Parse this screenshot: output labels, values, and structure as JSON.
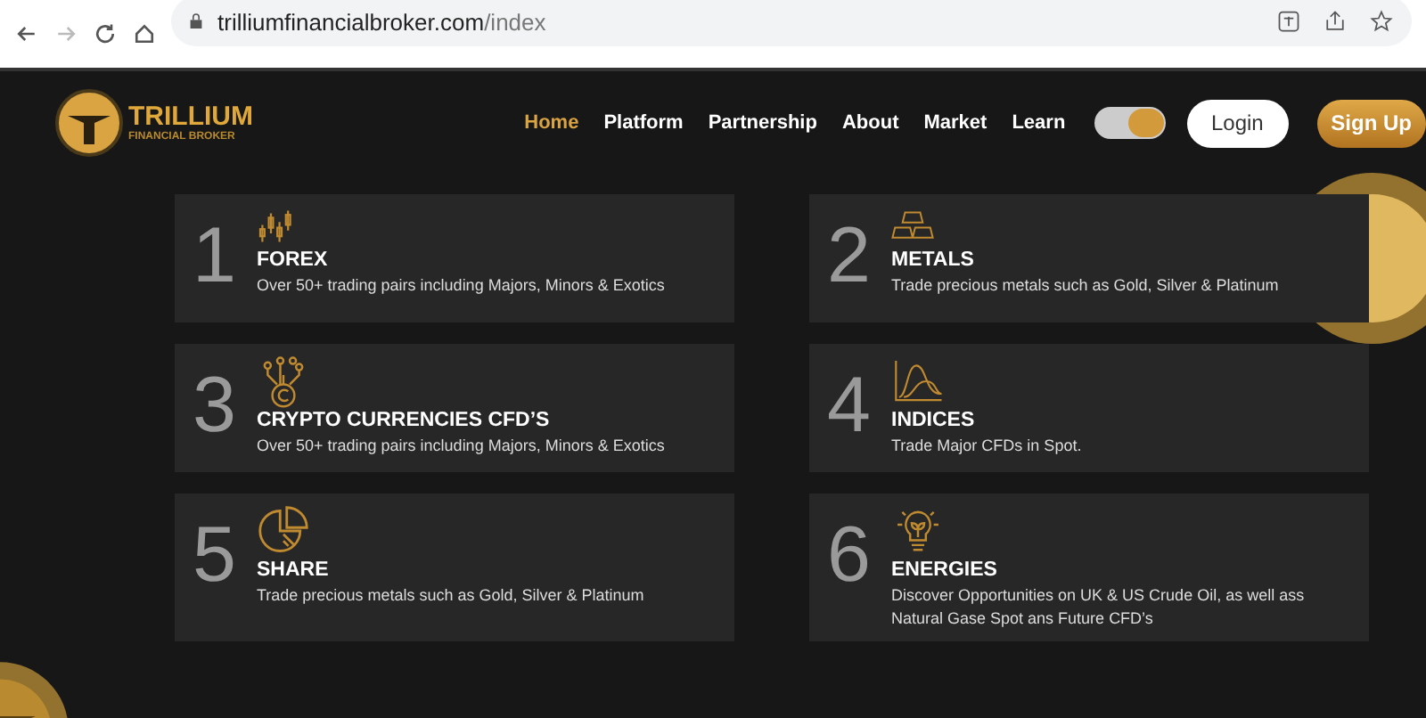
{
  "browser": {
    "url_host": "trilliumfinancialbroker.com",
    "url_path": "/index"
  },
  "logo": {
    "name": "TRILLIUM",
    "tagline": "FINANCIAL BROKER"
  },
  "nav": [
    {
      "label": "Home",
      "selected": true
    },
    {
      "label": "Platform",
      "selected": false
    },
    {
      "label": "Partnership",
      "selected": false
    },
    {
      "label": "About",
      "selected": false
    },
    {
      "label": "Market",
      "selected": false
    },
    {
      "label": "Learn",
      "selected": false
    }
  ],
  "theme_toggle": {
    "on": true
  },
  "buttons": [
    {
      "label": "Login",
      "kind": "outline"
    },
    {
      "label": "Sign Up",
      "kind": "primary"
    }
  ],
  "cards": [
    {
      "number": "1",
      "kind": "candles",
      "title": "FOREX",
      "text": "Over 50+ trading pairs including Majors, Minors & Exotics"
    },
    {
      "number": "2",
      "kind": "bars",
      "title": "METALS",
      "text": "Trade precious metals such as Gold, Silver & Platinum"
    },
    {
      "number": "3",
      "kind": "crypto",
      "title": "CRYPTO CURRENCIES CFD’S",
      "text": "Over 50+ trading pairs including Majors, Minors & Exotics"
    },
    {
      "number": "4",
      "kind": "curve",
      "title": "INDICES",
      "text": "Trade Major CFDs in Spot."
    },
    {
      "number": "5",
      "kind": "pie",
      "title": "SHARE",
      "text": "Trade precious metals such as Gold, Silver & Platinum"
    },
    {
      "number": "6",
      "kind": "bulb",
      "title": "ENERGIES",
      "text": "Discover Opportunities on UK & US Crude Oil, as well ass Natural Gase Spot ans Future CFD’s"
    }
  ]
}
